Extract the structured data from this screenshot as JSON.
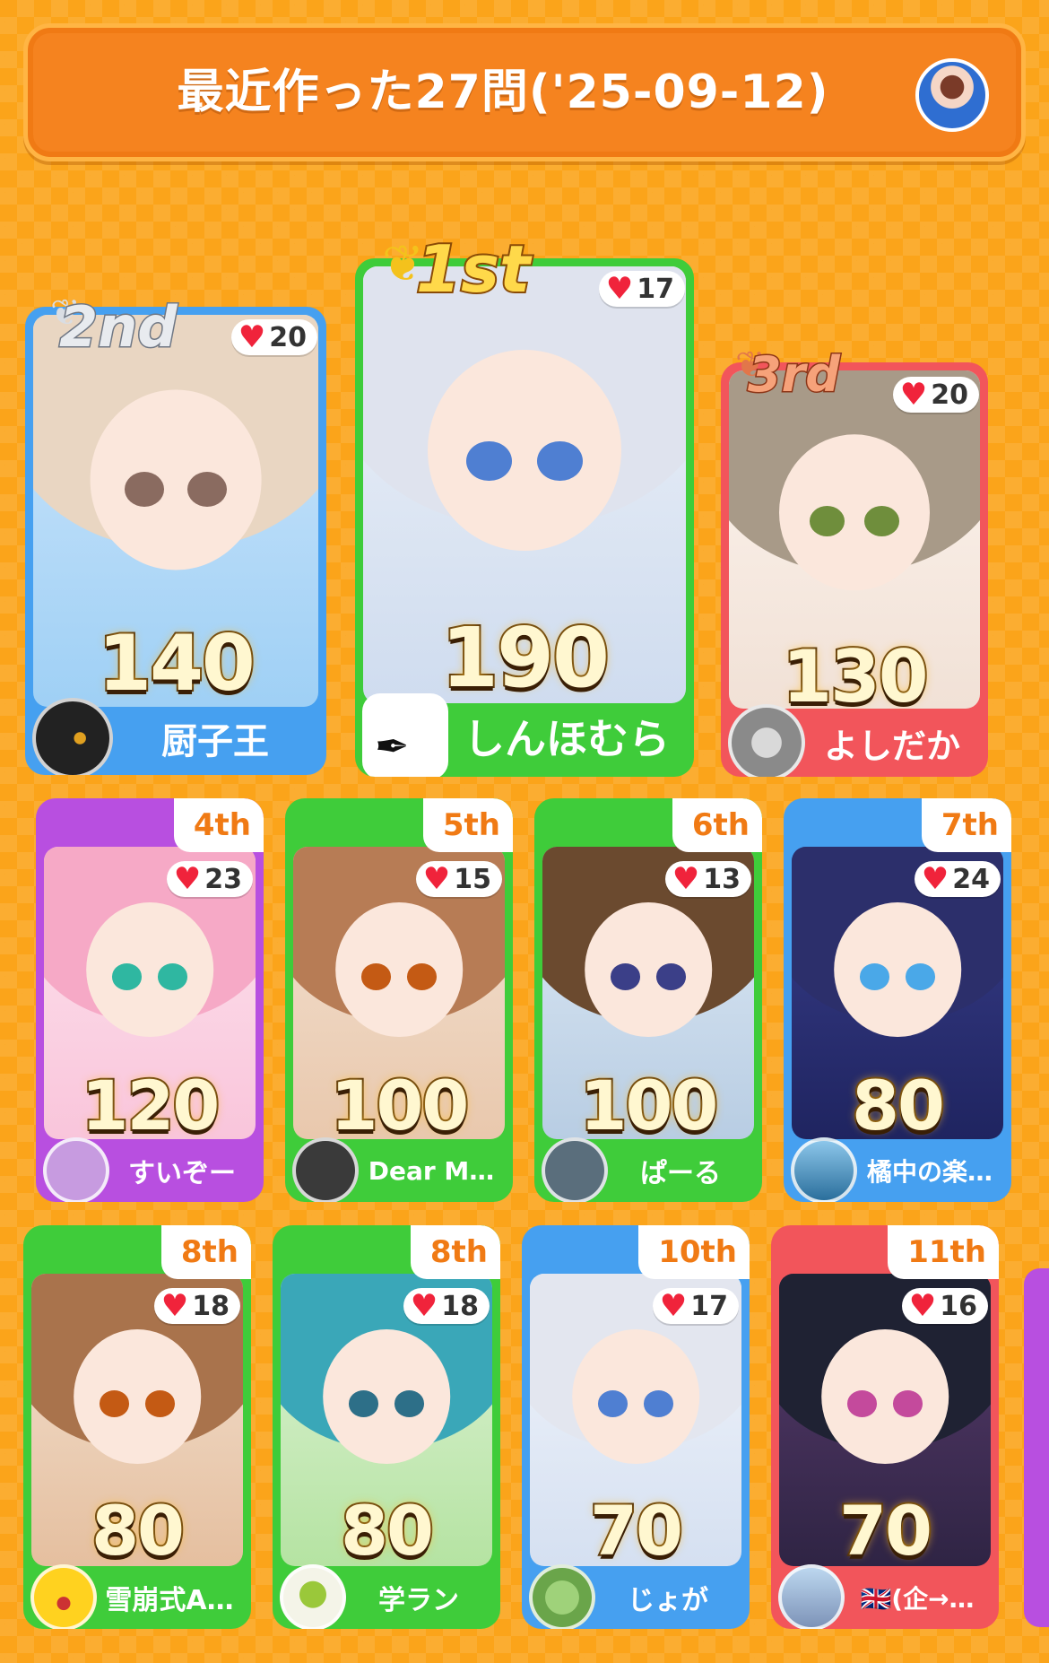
{
  "header": {
    "title": "最近作った27問('25-09-12)"
  },
  "top3": [
    {
      "rank_label": "2nd",
      "likes": "20",
      "score": "140",
      "name": "厨子王",
      "color": "blue"
    },
    {
      "rank_label": "1st",
      "likes": "17",
      "score": "190",
      "name": "しんほむら",
      "color": "green"
    },
    {
      "rank_label": "3rd",
      "likes": "20",
      "score": "130",
      "name": "よしだか",
      "color": "red"
    }
  ],
  "row2": [
    {
      "rank_label": "4th",
      "likes": "23",
      "score": "120",
      "name": "すいぞー",
      "color": "purple"
    },
    {
      "rank_label": "5th",
      "likes": "15",
      "score": "100",
      "name": "Dear M…",
      "color": "green"
    },
    {
      "rank_label": "6th",
      "likes": "13",
      "score": "100",
      "name": "ぱーる",
      "color": "green"
    },
    {
      "rank_label": "7th",
      "likes": "24",
      "score": "80",
      "name": "橘中の楽…",
      "color": "blue"
    }
  ],
  "row3": [
    {
      "rank_label": "8th",
      "likes": "18",
      "score": "80",
      "name": "雪崩式A…",
      "color": "green"
    },
    {
      "rank_label": "8th",
      "likes": "18",
      "score": "80",
      "name": "学ラン",
      "color": "green"
    },
    {
      "rank_label": "10th",
      "likes": "17",
      "score": "70",
      "name": "じょが",
      "color": "blue"
    },
    {
      "rank_label": "11th",
      "likes": "16",
      "score": "70",
      "name": "🇬🇧(企→…",
      "color": "red"
    }
  ],
  "icons": {
    "like": "heart-icon",
    "medal": "laurel-wreath-icon"
  },
  "colors": {
    "background": "#fba41a",
    "title_bar": "#f5831f",
    "green": "#3fcc3a",
    "blue": "#46a0f0",
    "red": "#f2555b",
    "purple": "#b84fe0",
    "heart": "#f0233b"
  }
}
